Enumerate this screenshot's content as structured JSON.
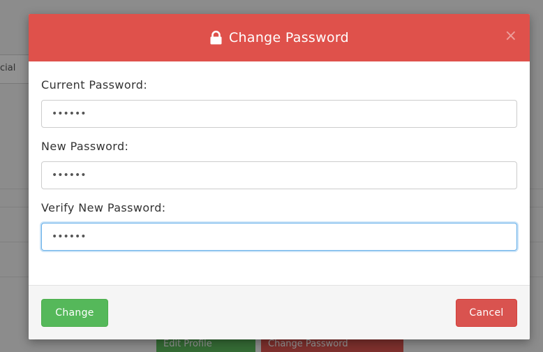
{
  "background": {
    "side_label": "cial",
    "edit_profile_label": "Edit Profile",
    "change_password_label": "Change Password"
  },
  "modal": {
    "title": "Change Password",
    "close_label": "×",
    "header_color": "#df514b",
    "fields": [
      {
        "label": "Current Password:",
        "value": "••••••"
      },
      {
        "label": "New Password:",
        "value": "••••••"
      },
      {
        "label": "Verify New Password:",
        "value": "••••••"
      }
    ],
    "change_label": "Change",
    "cancel_label": "Cancel",
    "icon": "lock-icon"
  }
}
